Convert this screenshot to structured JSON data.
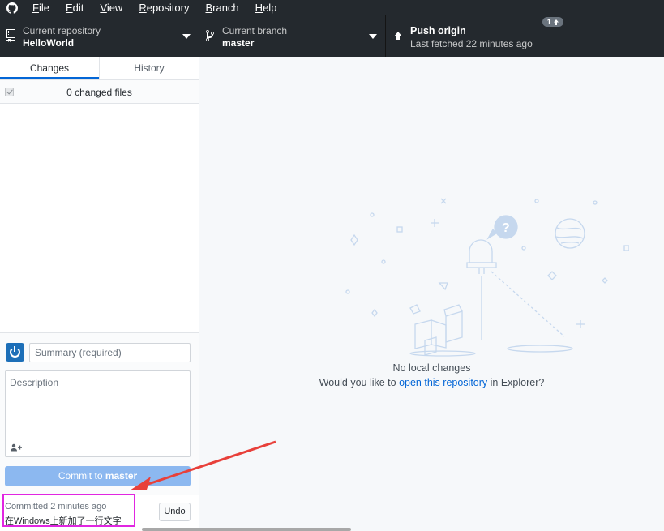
{
  "menu": {
    "items": [
      "File",
      "Edit",
      "View",
      "Repository",
      "Branch",
      "Help"
    ]
  },
  "toolbar": {
    "repo": {
      "label": "Current repository",
      "value": "HelloWorld"
    },
    "branch": {
      "label": "Current branch",
      "value": "master"
    },
    "push": {
      "label": "Push origin",
      "sub": "Last fetched 22 minutes ago",
      "badge": "1"
    }
  },
  "sidebar": {
    "tabs": [
      "Changes",
      "History"
    ],
    "changed_files": "0 changed files",
    "summary_placeholder": "Summary (required)",
    "description_placeholder": "Description",
    "commit_button_prefix": "Commit to ",
    "commit_button_branch": "master"
  },
  "last_commit": {
    "committed": "Committed 2 minutes ago",
    "message": "在Windows上新加了一行文字",
    "undo": "Undo"
  },
  "main": {
    "title": "No local changes",
    "sub_prefix": "Would you like to ",
    "sub_link": "open this repository",
    "sub_suffix": " in Explorer?"
  },
  "colors": {
    "toolbar_bg": "#24292e",
    "accent": "#0366d6",
    "commit_button": "#8cb8f0",
    "annotation_box": "#e126e1",
    "annotation_arrow": "#e8403a"
  }
}
